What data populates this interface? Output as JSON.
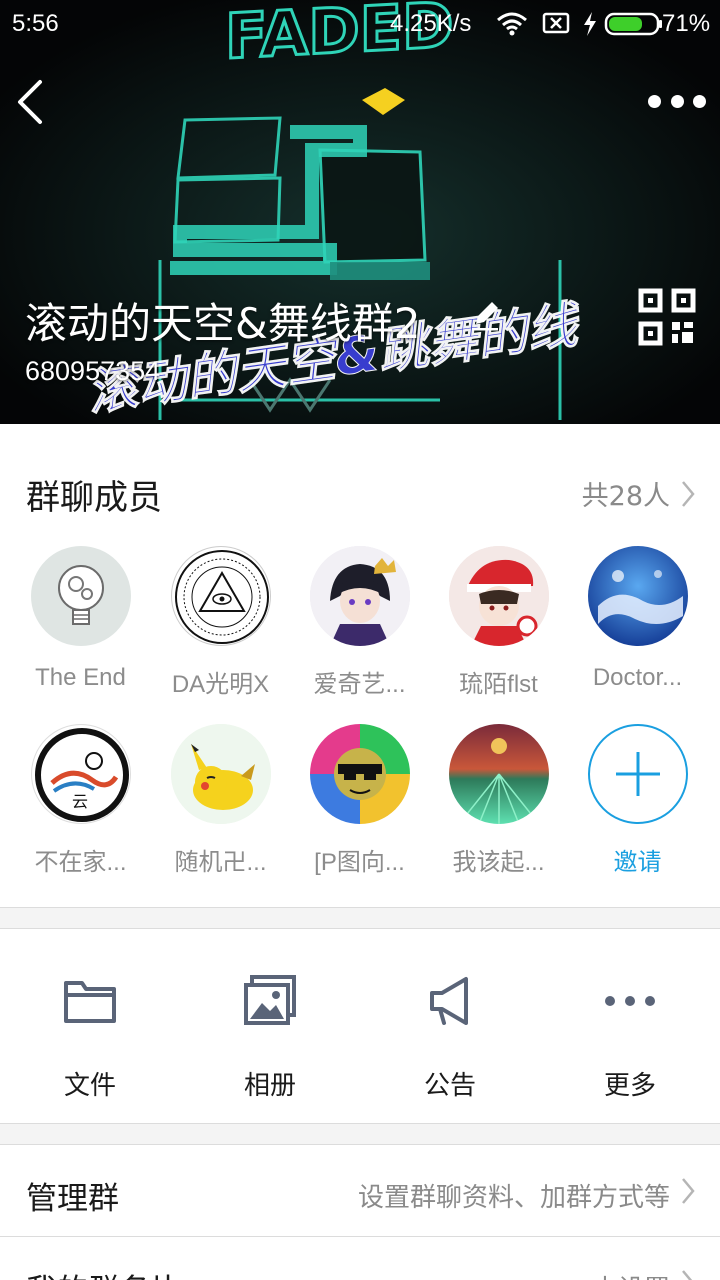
{
  "status_bar": {
    "time": "5:56",
    "net_speed": "4.25K/s",
    "battery_percent": "71%",
    "battery_level": 0.71,
    "icons": [
      "wifi-icon",
      "sim-off-icon",
      "charging-icon",
      "battery-icon"
    ]
  },
  "cover": {
    "art_text_top": "FADED",
    "art_text_overlay": "滚动的天空&跳舞的线"
  },
  "group": {
    "name": "滚动的天空&舞线群2",
    "id": "680957354"
  },
  "members": {
    "section_title": "群聊成员",
    "count_label": "共28人",
    "list": [
      {
        "name": "The End",
        "avatar": "lightbulb-gears"
      },
      {
        "name": "DA光明X",
        "avatar": "illuminati-eye"
      },
      {
        "name": "爱奇艺...",
        "avatar": "anime-boy-crown"
      },
      {
        "name": "琉陌flst",
        "avatar": "anime-trainer"
      },
      {
        "name": "Doctor...",
        "avatar": "blue-sky"
      },
      {
        "name": "不在家...",
        "avatar": "ink-circle"
      },
      {
        "name": "随机卍...",
        "avatar": "pikachu"
      },
      {
        "name": "[P图向...",
        "avatar": "colorful-sunglasses"
      },
      {
        "name": "我该起...",
        "avatar": "green-landscape"
      }
    ],
    "invite_label": "邀请"
  },
  "actions": [
    {
      "label": "文件",
      "icon": "folder-icon"
    },
    {
      "label": "相册",
      "icon": "album-icon"
    },
    {
      "label": "公告",
      "icon": "megaphone-icon"
    },
    {
      "label": "更多",
      "icon": "more-dots-icon"
    }
  ],
  "settings": {
    "manage_label": "管理群",
    "manage_value": "设置群聊资料、加群方式等",
    "card_label": "我的群名片",
    "card_value": "未设置"
  },
  "colors": {
    "accent": "#1a9fe0",
    "battery_green": "#3ecf2a",
    "art_neon": "#2fd4b8"
  }
}
